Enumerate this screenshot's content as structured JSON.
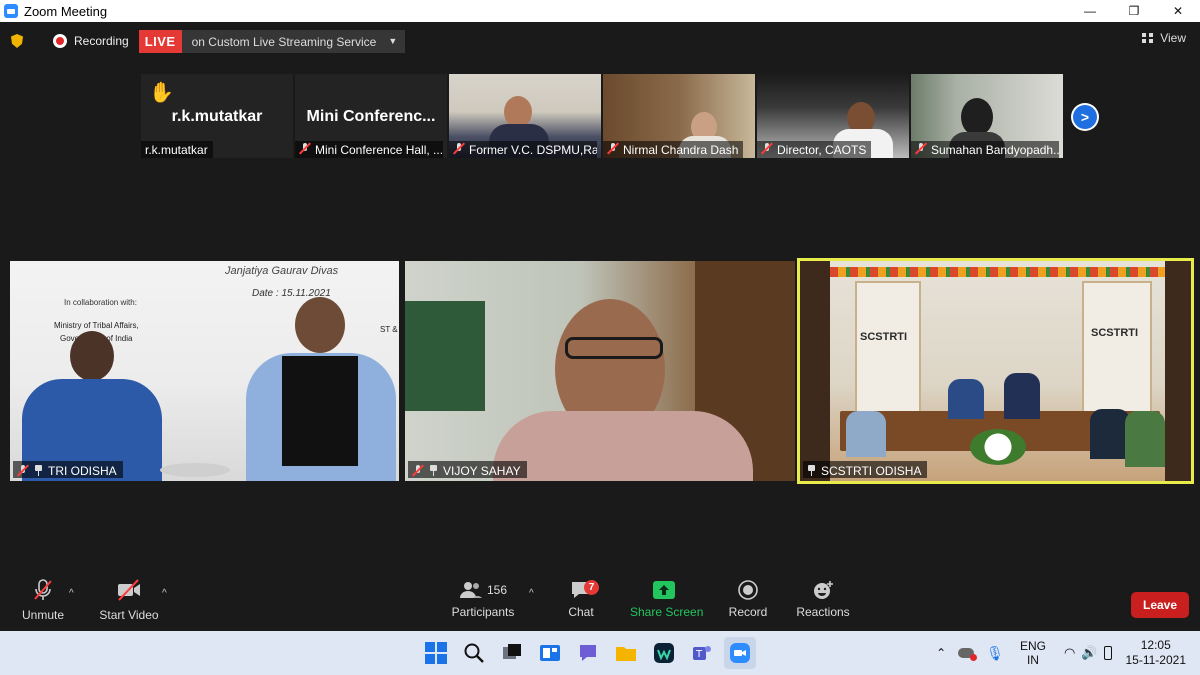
{
  "window": {
    "title": "Zoom Meeting",
    "minimize": "—",
    "restore": "❐",
    "close": "✕"
  },
  "meeting_bar": {
    "recording_label": "Recording",
    "live_badge": "LIVE",
    "stream_service": "on Custom Live Streaming Service",
    "view_label": "View"
  },
  "thumbnails": [
    {
      "display_name": "r.k.mutatkar",
      "label": "r.k.mutatkar",
      "muted": false,
      "hand_raised": true
    },
    {
      "display_name": "Mini  Conferenc...",
      "label": "Mini Conference Hall, ...",
      "muted": true
    },
    {
      "label": "Former V.C. DSPMU,Ra...",
      "muted": true
    },
    {
      "label": "Nirmal Chandra Dash",
      "muted": true
    },
    {
      "label": "Director, CAOTS",
      "muted": true
    },
    {
      "label": "Sumahan Bandyopadh...",
      "muted": true
    }
  ],
  "gallery": [
    {
      "label": "TRI ODISHA",
      "banner_lines": [
        "Janjatiya Gaurav Divas",
        "Date : 15.11.2021",
        "In collaboration with:",
        "Ministry of Tribal Affairs,",
        "Government of India",
        "ST &"
      ]
    },
    {
      "label": "VIJOY SAHAY"
    },
    {
      "label": "SCSTRTI ODISHA",
      "banner_left": "SCSTRTI",
      "banner_right": "SCSTRTI",
      "active_speaker": true
    }
  ],
  "controls": {
    "unmute": "Unmute",
    "start_video": "Start Video",
    "participants": "Participants",
    "participants_count": "156",
    "chat": "Chat",
    "chat_badge": "7",
    "share_screen": "Share Screen",
    "record": "Record",
    "reactions": "Reactions",
    "leave": "Leave"
  },
  "taskbar": {
    "lang_line1": "ENG",
    "lang_line2": "IN",
    "time": "12:05",
    "date": "15-11-2021"
  },
  "colors": {
    "live": "#e53935",
    "leave": "#c9201f",
    "share": "#22c55e",
    "active_border": "#e8ec4b",
    "zoom_blue": "#2d8cff"
  }
}
